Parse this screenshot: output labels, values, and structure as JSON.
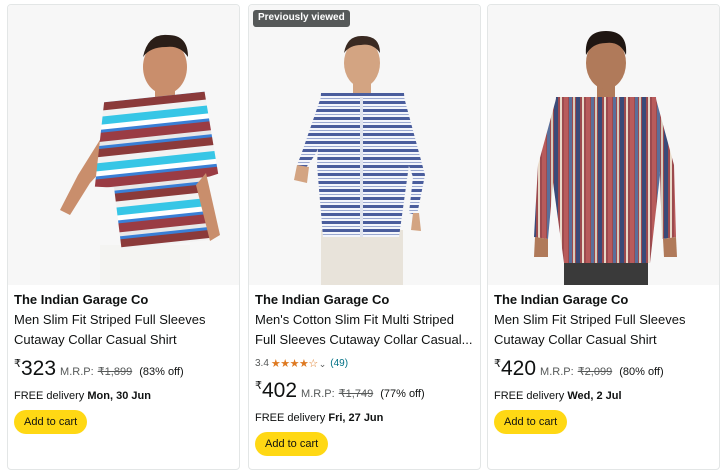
{
  "products": [
    {
      "brand": "The Indian Garage Co",
      "title": "Men Slim Fit Striped Full Sleeves Cutaway Collar Casual Shirt",
      "currency": "₹",
      "price": "323",
      "mrp_label": "M.R.P:",
      "mrp": "₹1,899",
      "discount": "(83% off)",
      "delivery_label": "FREE delivery",
      "delivery_date": "Mon, 30 Jun",
      "cart_label": "Add to cart"
    },
    {
      "badge": "Previously viewed",
      "brand": "The Indian Garage Co",
      "title": "Men's Cotton Slim Fit Multi Striped Full Sleeves Cutaway Collar Casual...",
      "rating": "3.4",
      "stars_value": 3.4,
      "review_count": "(49)",
      "currency": "₹",
      "price": "402",
      "mrp_label": "M.R.P:",
      "mrp": "₹1,749",
      "discount": "(77% off)",
      "delivery_label": "FREE delivery",
      "delivery_date": "Fri, 27 Jun",
      "cart_label": "Add to cart"
    },
    {
      "brand": "The Indian Garage Co",
      "title": "Men Slim Fit Striped Full Sleeves Cutaway Collar Casual Shirt",
      "currency": "₹",
      "price": "420",
      "mrp_label": "M.R.P:",
      "mrp": "₹2,099",
      "discount": "(80% off)",
      "delivery_label": "FREE delivery",
      "delivery_date": "Wed, 2 Jul",
      "cart_label": "Add to cart"
    }
  ],
  "colors": {
    "cart_button": "#ffd814",
    "star": "#de7921",
    "link": "#007185",
    "badge": "#565959"
  }
}
